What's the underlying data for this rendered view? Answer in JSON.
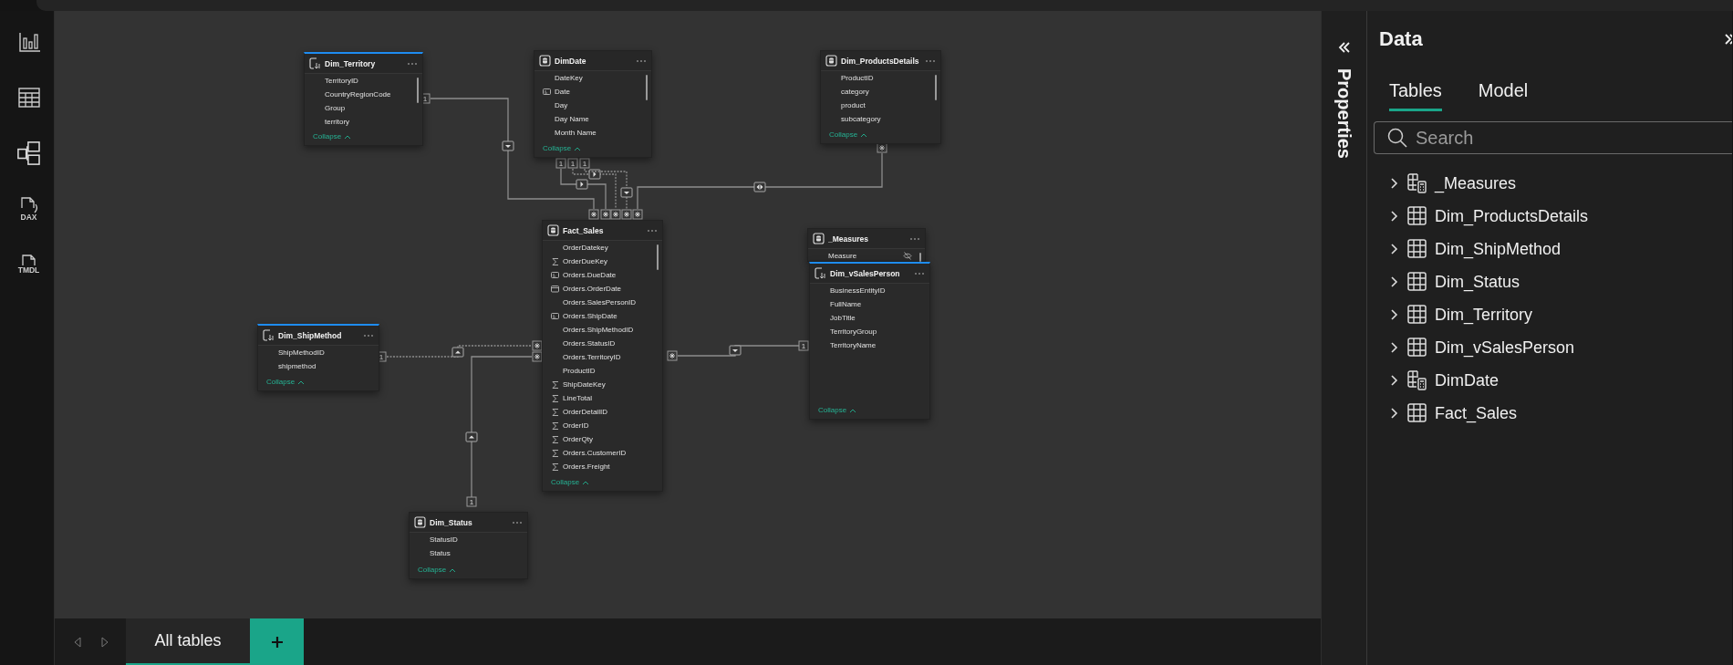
{
  "nav": [
    {
      "kind": "report",
      "selected": false
    },
    {
      "kind": "table",
      "selected": false
    },
    {
      "kind": "model",
      "selected": true
    },
    {
      "kind": "dax",
      "selected": false,
      "label": "DAX"
    },
    {
      "kind": "tmdl",
      "selected": false,
      "label": "TMDL"
    }
  ],
  "tables": [
    {
      "name": "Dim_Territory",
      "kind": "directquery",
      "scrollbar": true,
      "collapse": "Collapse",
      "fields": [
        {
          "name": "TerritoryID",
          "kind": "text"
        },
        {
          "name": "CountryRegionCode",
          "kind": "text"
        },
        {
          "name": "Group",
          "kind": "text"
        },
        {
          "name": "territory",
          "kind": "text"
        }
      ]
    },
    {
      "name": "DimDate",
      "kind": "import",
      "scrollbar": true,
      "collapse": "Collapse",
      "fields": [
        {
          "name": "DateKey",
          "kind": "text"
        },
        {
          "name": "Date",
          "kind": "datekey"
        },
        {
          "name": "Day",
          "kind": "text"
        },
        {
          "name": "Day Name",
          "kind": "text"
        },
        {
          "name": "Month Name",
          "kind": "text"
        }
      ]
    },
    {
      "name": "Dim_ProductsDetails",
      "kind": "import",
      "scrollbar": true,
      "collapse": "Collapse",
      "fields": [
        {
          "name": "ProductID",
          "kind": "text"
        },
        {
          "name": "category",
          "kind": "text"
        },
        {
          "name": "product",
          "kind": "text"
        },
        {
          "name": "subcategory",
          "kind": "text"
        }
      ]
    },
    {
      "name": "Fact_Sales",
      "kind": "import",
      "scrollbar": true,
      "collapse": "Collapse",
      "fields": [
        {
          "name": "OrderDatekey",
          "kind": "text"
        },
        {
          "name": "OrderDueKey",
          "kind": "sum"
        },
        {
          "name": "Orders.DueDate",
          "kind": "datekey"
        },
        {
          "name": "Orders.OrderDate",
          "kind": "calendar"
        },
        {
          "name": "Orders.SalesPersonID",
          "kind": "text"
        },
        {
          "name": "Orders.ShipDate",
          "kind": "datekey"
        },
        {
          "name": "Orders.ShipMethodID",
          "kind": "text"
        },
        {
          "name": "Orders.StatusID",
          "kind": "text"
        },
        {
          "name": "Orders.TerritoryID",
          "kind": "text"
        },
        {
          "name": "ProductID",
          "kind": "text"
        },
        {
          "name": "ShipDateKey",
          "kind": "sum"
        },
        {
          "name": "LineTotal",
          "kind": "sum"
        },
        {
          "name": "OrderDetailID",
          "kind": "sum"
        },
        {
          "name": "OrderID",
          "kind": "sum"
        },
        {
          "name": "OrderQty",
          "kind": "sum"
        },
        {
          "name": "Orders.CustomerID",
          "kind": "sum"
        },
        {
          "name": "Orders.Freight",
          "kind": "sum"
        }
      ]
    },
    {
      "name": "_Measures",
      "kind": "import",
      "scrollbar": true,
      "fields": [
        {
          "name": "Measure",
          "kind": "text",
          "hidden": true
        }
      ]
    },
    {
      "name": "Dim_vSalesPerson",
      "kind": "directquery",
      "scrollbar": false,
      "collapse": "Collapse",
      "fields": [
        {
          "name": "BusinessEntityID",
          "kind": "text"
        },
        {
          "name": "FullName",
          "kind": "text"
        },
        {
          "name": "JobTitle",
          "kind": "text"
        },
        {
          "name": "TerritoryGroup",
          "kind": "text"
        },
        {
          "name": "TerritoryName",
          "kind": "text"
        }
      ]
    },
    {
      "name": "Dim_ShipMethod",
      "kind": "directquery",
      "scrollbar": false,
      "collapse": "Collapse",
      "fields": [
        {
          "name": "ShipMethodID",
          "kind": "text"
        },
        {
          "name": "shipmethod",
          "kind": "text"
        }
      ]
    },
    {
      "name": "Dim_Status",
      "kind": "import",
      "scrollbar": false,
      "collapse": "Collapse",
      "fields": [
        {
          "name": "StatusID",
          "kind": "text"
        },
        {
          "name": "Status",
          "kind": "text"
        }
      ]
    }
  ],
  "relationships": [
    {
      "kind": "one_to_many",
      "one_end": "1",
      "active": true
    },
    {
      "kind": "one_to_many",
      "one_end": "1",
      "active": true
    },
    {
      "kind": "one_to_many",
      "one_end": "1",
      "active": false
    },
    {
      "kind": "one_to_many",
      "one_end": "1",
      "active": false
    },
    {
      "kind": "many_to_many",
      "active": true
    },
    {
      "kind": "one_to_many",
      "one_end": "1",
      "active": false
    },
    {
      "kind": "one_to_many",
      "one_end": "1",
      "active": true
    },
    {
      "kind": "one_to_many",
      "one_end": "1",
      "active": true
    }
  ],
  "layout_tabs": [
    {
      "label": "All tables",
      "selected": true
    }
  ],
  "properties_pane": {
    "title": "Properties"
  },
  "data_pane": {
    "title": "Data",
    "tabs": [
      {
        "label": "Tables",
        "selected": true
      },
      {
        "label": "Model",
        "selected": false
      }
    ],
    "search": {
      "placeholder": "Search"
    },
    "items": [
      {
        "name": "_Measures",
        "kind": "calc",
        "expanded": false
      },
      {
        "name": "Dim_ProductsDetails",
        "kind": "table",
        "expanded": false
      },
      {
        "name": "Dim_ShipMethod",
        "kind": "table",
        "expanded": false
      },
      {
        "name": "Dim_Status",
        "kind": "table",
        "expanded": false
      },
      {
        "name": "Dim_Territory",
        "kind": "table",
        "expanded": false
      },
      {
        "name": "Dim_vSalesPerson",
        "kind": "table",
        "expanded": false
      },
      {
        "name": "DimDate",
        "kind": "calc",
        "expanded": false
      },
      {
        "name": "Fact_Sales",
        "kind": "table",
        "expanded": false
      }
    ]
  }
}
